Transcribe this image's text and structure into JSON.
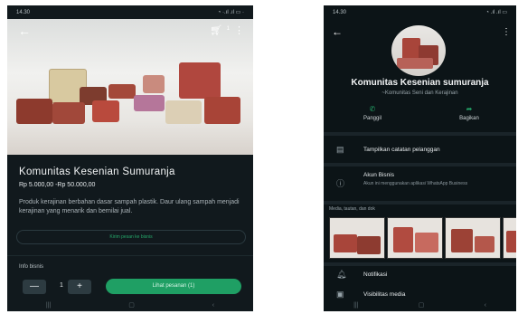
{
  "left_screen": {
    "status": {
      "time": "14.30",
      "icons": "◔ ·.ıl .ıl ▭ ·"
    },
    "cart_count": "1",
    "product_title": "Komunitas Kesenian Sumuranja",
    "price": "Rp 5.000,00 -Rp 50.000,00",
    "description": "Produk kerajinan berbahan dasar sampah plastik. Daur ulang sampah menjadi kerajinan yang menarik dan bernilai jual.",
    "message_business": "Kirim pesan ke bisnis",
    "info_label": "Info bisnis",
    "quantity": "1",
    "minus": "—",
    "plus": "+",
    "add_to_cart": "Lihat pesanan (1)"
  },
  "right_screen": {
    "status": {
      "time": "14.30",
      "icons": "◔ .ıl .ıl ▭"
    },
    "business_name": "Komunitas Kesenian sumuranja",
    "business_category": "~Komunitas Seni dan Kerajinan",
    "call_label": "Panggil",
    "share_label": "Bagikan",
    "customer_notes": "Tampilkan catatan pelanggan",
    "business_account_title": "Akun Bisnis",
    "business_account_sub": "Akun ini menggunakan aplikasi WhatsApp Business",
    "media_label": "Media, tautan, dan dok",
    "notifications": "Notifikasi",
    "media_visibility": "Visibilitas media"
  },
  "icons": {
    "back": "arrow-left-icon",
    "cart": "cart-icon",
    "menu": "kebab-menu-icon",
    "call": "phone-icon",
    "share": "share-icon",
    "notes": "notes-icon",
    "info": "info-icon",
    "bell": "bell-icon",
    "media": "image-icon"
  },
  "colors": {
    "accent_green": "#1f9f64",
    "dark_bg": "#11191d"
  }
}
